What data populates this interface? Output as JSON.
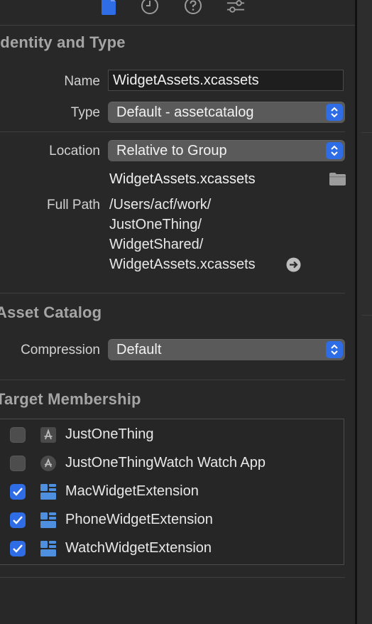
{
  "tabs": [
    {
      "icon": "file-icon",
      "active": true
    },
    {
      "icon": "history-clock-icon",
      "active": false
    },
    {
      "icon": "help-question-icon",
      "active": false
    },
    {
      "icon": "attributes-sliders-icon",
      "active": false
    }
  ],
  "identity": {
    "title": "Identity and Type",
    "name_label": "Name",
    "name_value": "WidgetAssets.xcassets",
    "type_label": "Type",
    "type_value": "Default - assetcatalog",
    "location_label": "Location",
    "location_value": "Relative to Group",
    "location_file": "WidgetAssets.xcassets",
    "fullpath_label": "Full Path",
    "fullpath_lines": [
      "/Users/acf/work/",
      "JustOneThing/",
      "WidgetShared/",
      "WidgetAssets.xcassets"
    ]
  },
  "asset_catalog": {
    "title": "Asset Catalog",
    "compression_label": "Compression",
    "compression_value": "Default"
  },
  "target_membership": {
    "title": "Target Membership",
    "targets": [
      {
        "label": "JustOneThing",
        "checked": false,
        "icon": "app-icon"
      },
      {
        "label": "JustOneThingWatch Watch App",
        "checked": false,
        "icon": "watch-app-icon"
      },
      {
        "label": "MacWidgetExtension",
        "checked": true,
        "icon": "widget-extension-icon"
      },
      {
        "label": "PhoneWidgetExtension",
        "checked": true,
        "icon": "widget-extension-icon"
      },
      {
        "label": "WatchWidgetExtension",
        "checked": true,
        "icon": "widget-extension-icon"
      }
    ]
  },
  "colors": {
    "accent": "#2f6de6",
    "background": "#282828",
    "section_title": "#a5a5a5"
  }
}
